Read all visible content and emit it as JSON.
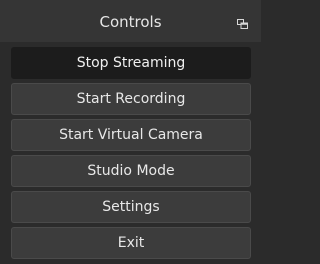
{
  "dock": {
    "title": "Controls",
    "float_icon": "undock-icon"
  },
  "buttons": [
    {
      "label": "Stop Streaming",
      "state": "active"
    },
    {
      "label": "Start Recording"
    },
    {
      "label": "Start Virtual Camera"
    },
    {
      "label": "Studio Mode"
    },
    {
      "label": "Settings"
    },
    {
      "label": "Exit"
    }
  ],
  "colors": {
    "panel_bg": "#2b2b2b",
    "header_bg": "#353535",
    "button_bg": "#3c3c3c",
    "active_button_bg": "#1c1c1c",
    "text": "#e8e8e8"
  }
}
